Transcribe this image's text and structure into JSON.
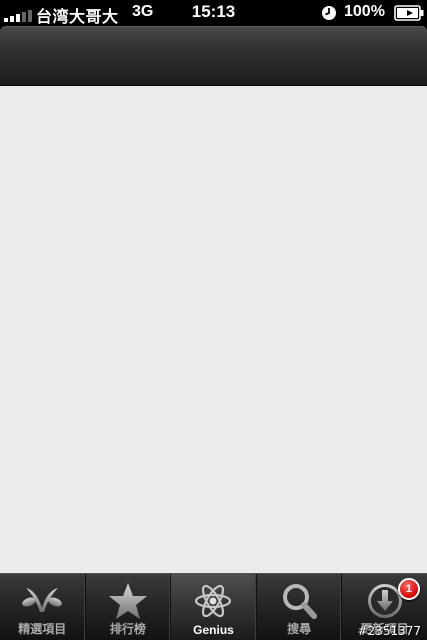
{
  "status_bar": {
    "carrier": "台湾大哥大",
    "network": "3G",
    "time": "15:13",
    "battery": "100%"
  },
  "tabs": [
    {
      "label": "精選項目",
      "icon": "featured-icon",
      "selected": false
    },
    {
      "label": "排行榜",
      "icon": "star-icon",
      "selected": false
    },
    {
      "label": "Genius",
      "icon": "atom-icon",
      "selected": true
    },
    {
      "label": "搜尋",
      "icon": "search-icon",
      "selected": false
    },
    {
      "label": "更新項目",
      "icon": "download-icon",
      "selected": false,
      "badge": "1"
    }
  ],
  "watermark": "#2351377",
  "colors": {
    "content_bg": "#ebebeb",
    "badge": "#d40000"
  }
}
